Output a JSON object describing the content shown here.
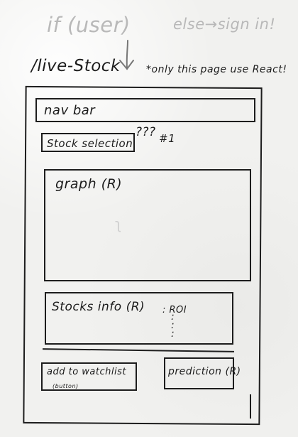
{
  "header": {
    "if_user": "if (user)",
    "else_sign_in": "else→sign in!",
    "route": "/live-Stock",
    "note": "*only this page use React!"
  },
  "wireframe": {
    "nav_bar": "nav bar",
    "stock_selection": "Stock selection",
    "question_marks": "???",
    "hash_mark": "#1",
    "graph": "graph (R)",
    "stocks_info": "Stocks info (R)",
    "roi": ": ROI",
    "dots": ":\n:\n:",
    "add_to_watchlist": "add to watchlist",
    "button_label": "(button)",
    "prediction": "prediction (R)"
  }
}
